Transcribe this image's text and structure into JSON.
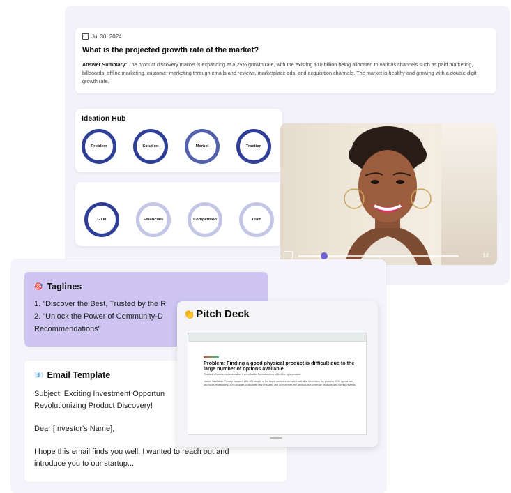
{
  "summary": {
    "date": "Jul 30, 2024",
    "question": "What is the projected growth rate of the market?",
    "answer_label": "Answer Summary:",
    "answer_text": "The product discovery market is expanding at a 25% growth rate, with the existing $10 billion being allocated to various channels such as paid marketing, billboards, offline marketing, customer marketing through emails and reviews, marketplace ads, and acquisition channels. The market is healthy and growing with a double-digit growth rate."
  },
  "ideation_hub": {
    "title": "Ideation Hub",
    "row1": [
      "Problem",
      "Solution",
      "Market",
      "Traction"
    ],
    "row2": [
      "GTM",
      "Financials",
      "Competition",
      "Team"
    ]
  },
  "video": {
    "time": "14"
  },
  "taglines": {
    "icon": "target-icon",
    "title": "Taglines",
    "line1": "1. \"Discover the Best, Trusted by the R",
    "line2": "2. \"Unlock the Power of Community-D",
    "line3": "Recommendations\""
  },
  "email": {
    "icon": "envelope-icon",
    "title": "Email Template",
    "subject_1": "Subject: Exciting Investment Opportun",
    "subject_2": "Revolutionizing Product Discovery!",
    "greeting": "Dear [Investor's Name],",
    "body_1": "I hope this email finds you well. I wanted to reach out and",
    "body_2": "introduce you to our startup..."
  },
  "pitch_deck": {
    "icon": "clapping-hands-icon",
    "title": "Pitch Deck",
    "slide_heading": "Problem: Finding a good physical product is difficult due to the large number of options available.",
    "slide_subtitle": "The lack of trust in reviews makes it even harder for consumers to find the right product.",
    "slide_text": "Market Validation: Primary research with 100 people of the target audience revealed that all of them have the problem. 20% spend over two hours researching, 30% struggle to discover new products, and 50% of men feel anxious due to similar products with varying reviews."
  },
  "colors": {
    "accent": "#2f3f98",
    "accent_light": "#c3c6e5",
    "tagline_bg": "#cec5f2"
  }
}
